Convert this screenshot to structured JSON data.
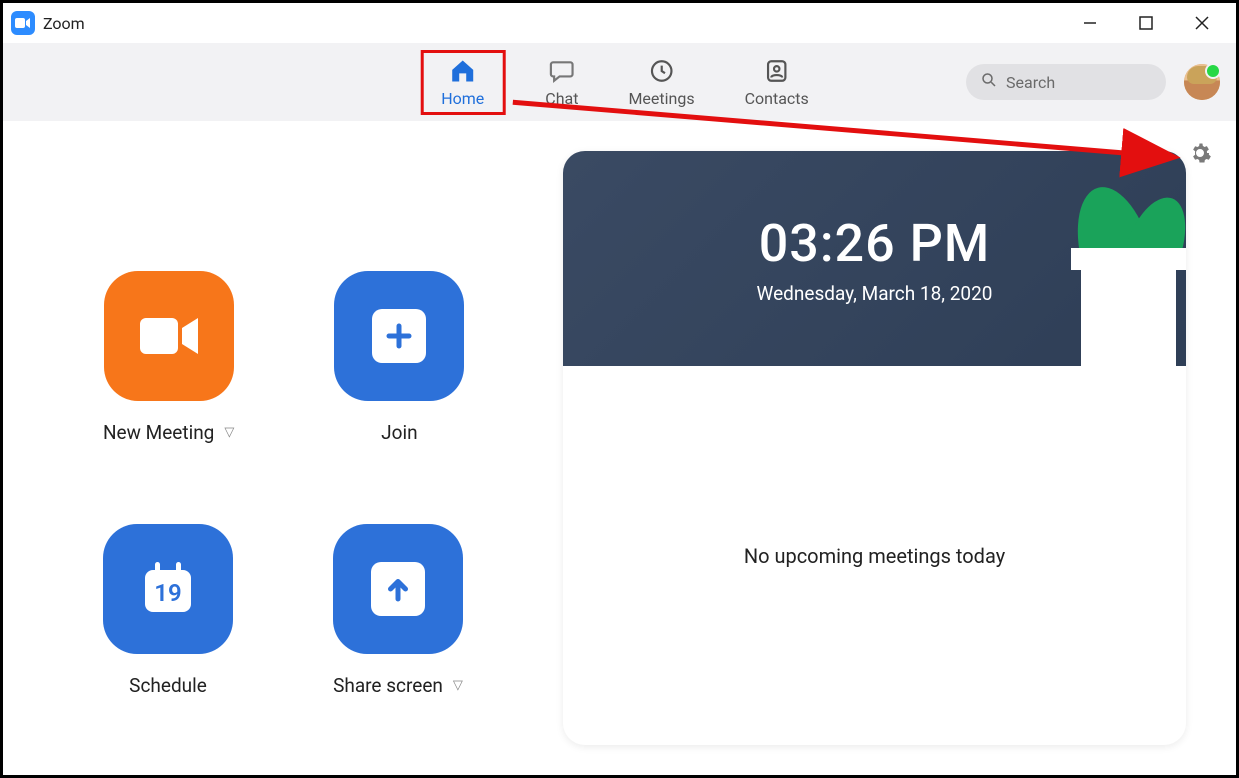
{
  "window": {
    "title": "Zoom"
  },
  "nav": {
    "tabs": [
      {
        "label": "Home"
      },
      {
        "label": "Chat"
      },
      {
        "label": "Meetings"
      },
      {
        "label": "Contacts"
      }
    ],
    "search_placeholder": "Search"
  },
  "tiles": {
    "new_meeting": "New Meeting",
    "join": "Join",
    "schedule": "Schedule",
    "share_screen": "Share screen"
  },
  "hero": {
    "time": "03:26 PM",
    "date": "Wednesday, March 18, 2020"
  },
  "right_body": "No upcoming meetings today",
  "calendar_day": "19"
}
